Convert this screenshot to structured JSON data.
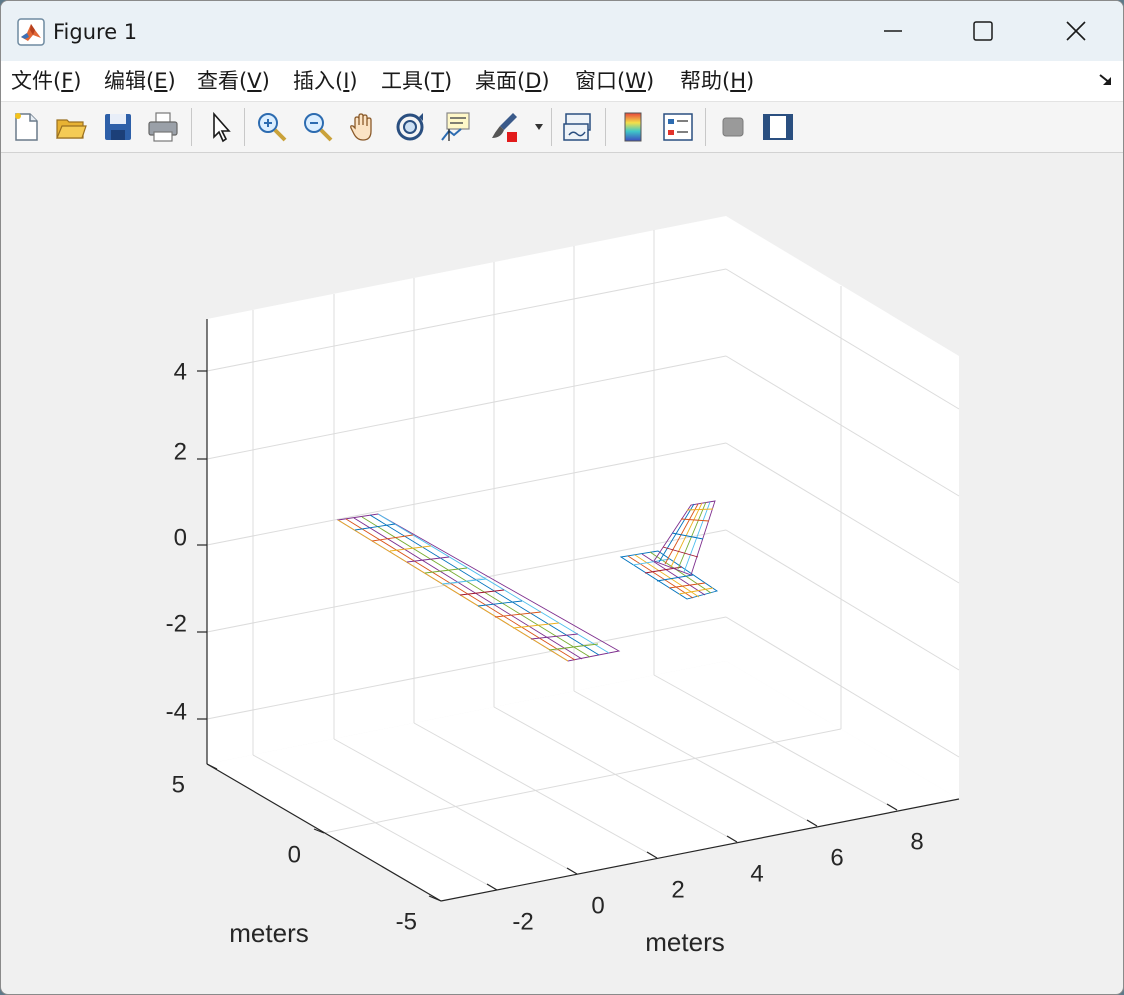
{
  "window": {
    "title": "Figure 1",
    "icon": "matlab-logo-icon",
    "controls": [
      "minimize-icon",
      "maximize-icon",
      "close-icon"
    ]
  },
  "menu": {
    "items": [
      {
        "label": "文件(",
        "key": "F",
        "end": ")"
      },
      {
        "label": "编辑(",
        "key": "E",
        "end": ")"
      },
      {
        "label": "查看(",
        "key": "V",
        "end": ")"
      },
      {
        "label": "插入(",
        "key": "I",
        "end": ")"
      },
      {
        "label": "工具(",
        "key": "T",
        "end": ")"
      },
      {
        "label": "桌面(",
        "key": "D",
        "end": ")"
      },
      {
        "label": "窗口(",
        "key": "W",
        "end": ")"
      },
      {
        "label": "帮助(",
        "key": "H",
        "end": ")"
      }
    ]
  },
  "toolbar": {
    "buttons": [
      "new-figure-icon",
      "open-file-icon",
      "save-icon",
      "print-icon",
      "edit-plot-cursor-icon",
      "zoom-in-icon",
      "zoom-out-icon",
      "pan-hand-icon",
      "rotate-3d-icon",
      "data-cursor-icon",
      "brush-icon",
      "link-plot-icon",
      "colorbar-icon",
      "legend-icon",
      "hide-plot-tools-icon",
      "show-plot-tools-icon"
    ]
  },
  "axes": {
    "x_ticks": [
      "-2",
      "0",
      "2",
      "4",
      "6",
      "8"
    ],
    "y_ticks": [
      "5",
      "0",
      "-5"
    ],
    "z_ticks": [
      "4",
      "2",
      "0",
      "-2",
      "-4"
    ],
    "x_label": "meters",
    "y_label": "meters",
    "grid": true,
    "colors": {
      "axis": "#262626",
      "grid": "#dcdcdc",
      "background": "#ffffff"
    }
  },
  "plot": {
    "type": "3d-mesh",
    "description_colors": [
      "#0072bd",
      "#d95319",
      "#edb120",
      "#7e2f8e",
      "#77ac30",
      "#4dbeee",
      "#a2142f"
    ]
  }
}
